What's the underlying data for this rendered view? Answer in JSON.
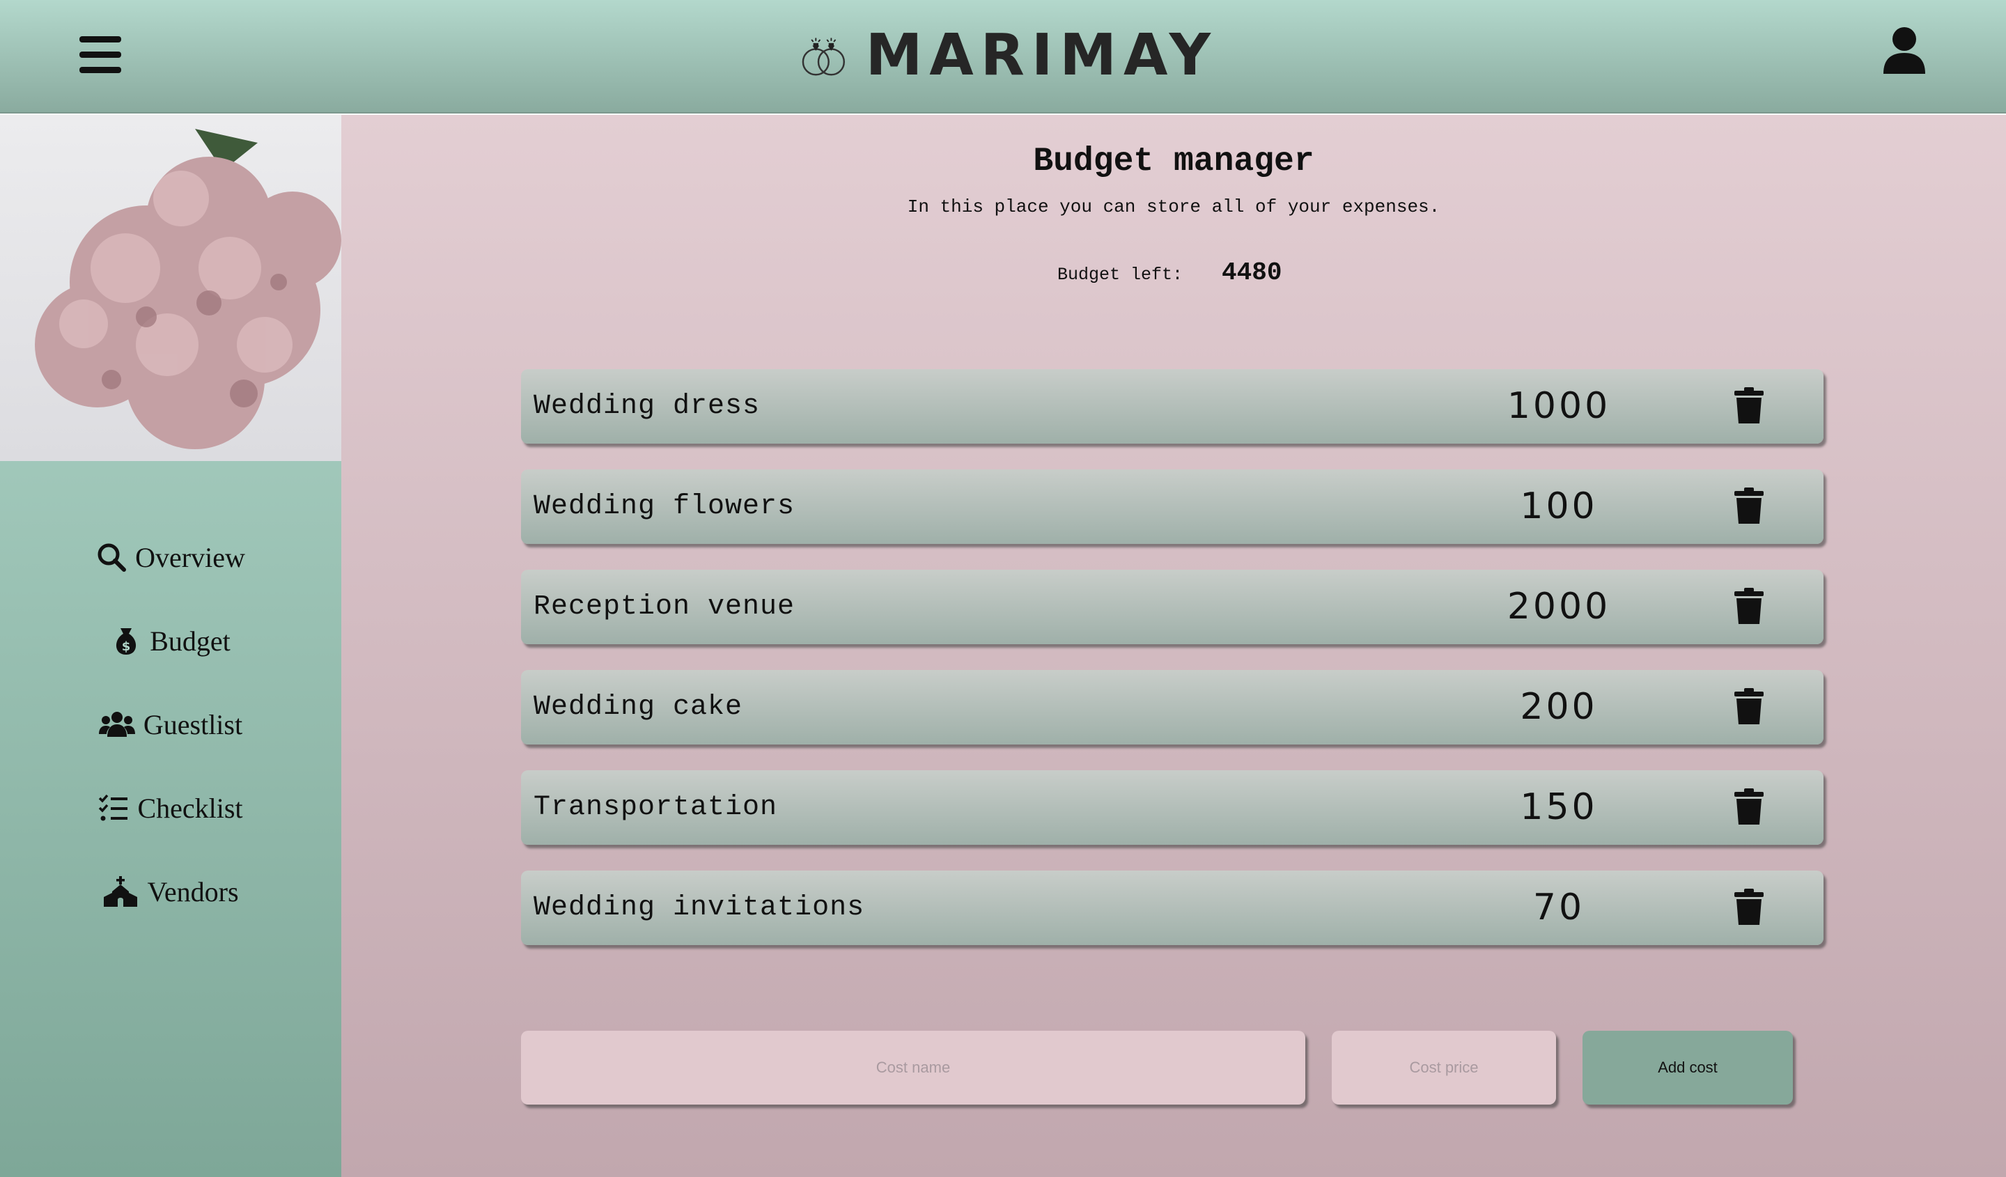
{
  "header": {
    "menu_icon": "hamburger-menu-icon",
    "logo_icon": "wedding-rings-icon",
    "logo_text": "MARIMAY",
    "user_icon": "user-profile-icon"
  },
  "sidebar": {
    "photo": "pink-hydrangea-flowers-photo",
    "items": [
      {
        "label": "Overview",
        "icon": "search-icon"
      },
      {
        "label": "Budget",
        "icon": "money-bag-icon"
      },
      {
        "label": "Guestlist",
        "icon": "users-icon"
      },
      {
        "label": "Checklist",
        "icon": "checklist-icon"
      },
      {
        "label": "Vendors",
        "icon": "church-icon"
      }
    ]
  },
  "main": {
    "title": "Budget manager",
    "subtitle": "In this place you can store all of your expenses.",
    "budget_left_label": "Budget left:",
    "budget_left_value": "4480",
    "costs": [
      {
        "name": "Wedding dress",
        "price": "1000"
      },
      {
        "name": "Wedding flowers",
        "price": "100"
      },
      {
        "name": "Reception venue",
        "price": "2000"
      },
      {
        "name": "Wedding cake",
        "price": "200"
      },
      {
        "name": "Transportation",
        "price": "150"
      },
      {
        "name": "Wedding invitations",
        "price": "70"
      }
    ],
    "form": {
      "cost_name_placeholder": "Cost name",
      "cost_price_placeholder": "Cost price",
      "add_button_label": "Add cost"
    }
  },
  "colors": {
    "header_top": "#b3d8cc",
    "header_bottom": "#8aab9f",
    "main_top": "#e3ced3",
    "main_bottom": "#c1a7ae",
    "row": "#b3bfba",
    "add_button": "#86a89a"
  }
}
